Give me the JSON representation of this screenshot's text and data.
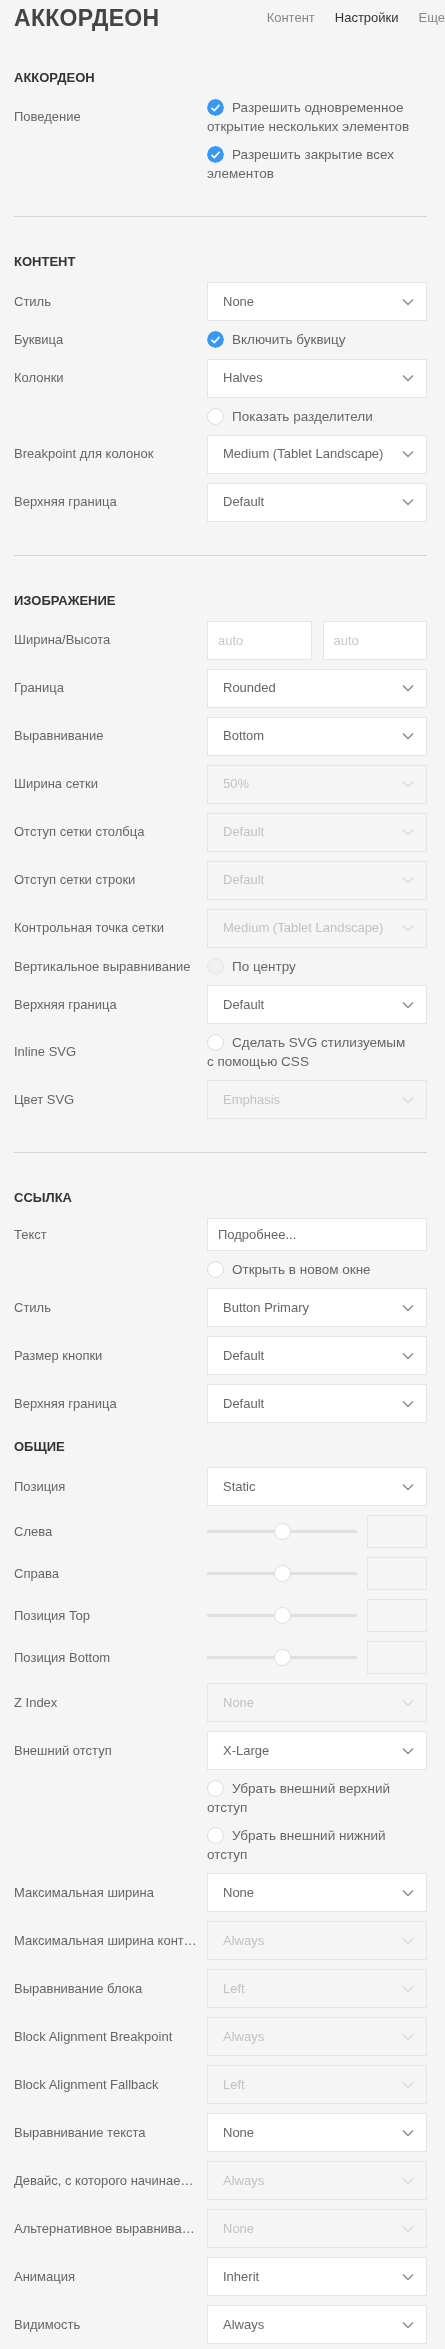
{
  "header": {
    "title": "АККОРДЕОН",
    "tabs": [
      {
        "label": "Контент",
        "selected": false
      },
      {
        "label": "Настройки",
        "selected": true
      },
      {
        "label": "Еще",
        "selected": false
      }
    ]
  },
  "sections": [
    {
      "heading": "АККОРДЕОН",
      "divider": true,
      "rows": [
        {
          "label": "Поведение",
          "controls": [
            {
              "kind": "checkbox",
              "text": "Разрешить одновременное открытие нескольких элементов",
              "checked": true,
              "disabled": false
            },
            {
              "kind": "checkbox",
              "text": "Разрешить закрытие всех элементов",
              "checked": true,
              "disabled": false
            }
          ]
        }
      ]
    },
    {
      "heading": "КОНТЕНТ",
      "divider": true,
      "rows": [
        {
          "label": "Стиль",
          "controls": [
            {
              "kind": "select",
              "value": "None",
              "disabled": false
            }
          ]
        },
        {
          "label": "Буквица",
          "controls": [
            {
              "kind": "checkbox",
              "text": "Включить буквицу",
              "checked": true,
              "disabled": false
            }
          ]
        },
        {
          "label": "Колонки",
          "controls": [
            {
              "kind": "select",
              "value": "Halves",
              "disabled": false
            },
            {
              "kind": "checkbox",
              "text": "Показать разделители",
              "checked": false,
              "disabled": false
            }
          ]
        },
        {
          "label": "Breakpoint для колонок",
          "controls": [
            {
              "kind": "select",
              "value": "Medium (Tablet Landscape)",
              "disabled": false
            }
          ]
        },
        {
          "label": "Верхняя граница",
          "controls": [
            {
              "kind": "select",
              "value": "Default",
              "disabled": false
            }
          ]
        }
      ]
    },
    {
      "heading": "ИЗОБРАЖЕНИЕ",
      "divider": true,
      "rows": [
        {
          "label": "Ширина/Высота",
          "controls": [
            {
              "kind": "pair",
              "fields": [
                {
                  "placeholder": "auto"
                },
                {
                  "placeholder": "auto"
                }
              ]
            }
          ]
        },
        {
          "label": "Граница",
          "controls": [
            {
              "kind": "select",
              "value": "Rounded",
              "disabled": false
            }
          ]
        },
        {
          "label": "Выравнивание",
          "controls": [
            {
              "kind": "select",
              "value": "Bottom",
              "disabled": false
            }
          ]
        },
        {
          "label": "Ширина сетки",
          "controls": [
            {
              "kind": "select",
              "value": "50%",
              "disabled": true
            }
          ]
        },
        {
          "label": "Отступ сетки столбца",
          "controls": [
            {
              "kind": "select",
              "value": "Default",
              "disabled": true
            }
          ]
        },
        {
          "label": "Отступ сетки строки",
          "controls": [
            {
              "kind": "select",
              "value": "Default",
              "disabled": true
            }
          ]
        },
        {
          "label": "Контрольная точка сетки",
          "controls": [
            {
              "kind": "select",
              "value": "Medium (Tablet Landscape)",
              "disabled": true
            }
          ]
        },
        {
          "label": "Вертикальное выравнивание",
          "controls": [
            {
              "kind": "checkbox",
              "text": "По центру",
              "checked": false,
              "disabled": true
            }
          ]
        },
        {
          "label": "Верхняя граница",
          "controls": [
            {
              "kind": "select",
              "value": "Default",
              "disabled": false
            }
          ]
        },
        {
          "label": "Inline SVG",
          "controls": [
            {
              "kind": "checkbox",
              "text": "Сделать SVG стилизуемым с помощью CSS",
              "checked": false,
              "disabled": false
            }
          ]
        },
        {
          "label": "Цвет SVG",
          "controls": [
            {
              "kind": "select",
              "value": "Emphasis",
              "disabled": true
            }
          ]
        }
      ]
    },
    {
      "heading": "ССЫЛКА",
      "divider": false,
      "rows": [
        {
          "label": "Текст",
          "controls": [
            {
              "kind": "text",
              "value": "Подробнее..."
            },
            {
              "kind": "checkbox",
              "text": "Открыть в новом окне",
              "checked": false,
              "disabled": false
            }
          ]
        },
        {
          "label": "Стиль",
          "controls": [
            {
              "kind": "select",
              "value": "Button Primary",
              "disabled": false
            }
          ]
        },
        {
          "label": "Размер кнопки",
          "controls": [
            {
              "kind": "select",
              "value": "Default",
              "disabled": false
            }
          ]
        },
        {
          "label": "Верхняя граница",
          "controls": [
            {
              "kind": "select",
              "value": "Default",
              "disabled": false
            }
          ]
        }
      ]
    },
    {
      "heading": "ОБЩИЕ",
      "divider": false,
      "rows": [
        {
          "label": "Позиция",
          "controls": [
            {
              "kind": "select",
              "value": "Static",
              "disabled": false
            }
          ]
        },
        {
          "label": "Слева",
          "controls": [
            {
              "kind": "slider",
              "level": 0.5
            }
          ]
        },
        {
          "label": "Справа",
          "controls": [
            {
              "kind": "slider",
              "level": 0.5
            }
          ]
        },
        {
          "label": "Позиция Top",
          "controls": [
            {
              "kind": "slider",
              "level": 0.5
            }
          ]
        },
        {
          "label": "Позиция Bottom",
          "controls": [
            {
              "kind": "slider",
              "level": 0.5
            }
          ]
        },
        {
          "label": "Z Index",
          "controls": [
            {
              "kind": "select",
              "value": "None",
              "disabled": true
            }
          ]
        },
        {
          "label": "Внешний отступ",
          "controls": [
            {
              "kind": "select",
              "value": "X-Large",
              "disabled": false
            },
            {
              "kind": "checkbox",
              "text": "Убрать внешний верхний отступ",
              "checked": false,
              "disabled": false
            },
            {
              "kind": "checkbox",
              "text": "Убрать внешний нижний отступ",
              "checked": false,
              "disabled": false
            }
          ]
        },
        {
          "label": "Максимальная ширина",
          "controls": [
            {
              "kind": "select",
              "value": "None",
              "disabled": false
            }
          ]
        },
        {
          "label": "Максимальная ширина конт…",
          "controls": [
            {
              "kind": "select",
              "value": "Always",
              "disabled": true
            }
          ]
        },
        {
          "label": "Выравнивание блока",
          "controls": [
            {
              "kind": "select",
              "value": "Left",
              "disabled": true
            }
          ]
        },
        {
          "label": "Block Alignment Breakpoint",
          "controls": [
            {
              "kind": "select",
              "value": "Always",
              "disabled": true
            }
          ]
        },
        {
          "label": "Block Alignment Fallback",
          "controls": [
            {
              "kind": "select",
              "value": "Left",
              "disabled": true
            }
          ]
        },
        {
          "label": "Выравнивание текста",
          "controls": [
            {
              "kind": "select",
              "value": "None",
              "disabled": false
            }
          ]
        },
        {
          "label": "Девайс, с которого начинае…",
          "controls": [
            {
              "kind": "select",
              "value": "Always",
              "disabled": true
            }
          ]
        },
        {
          "label": "Альтернативное выравнива…",
          "controls": [
            {
              "kind": "select",
              "value": "None",
              "disabled": true
            }
          ]
        },
        {
          "label": "Анимация",
          "controls": [
            {
              "kind": "select",
              "value": "Inherit",
              "disabled": false
            }
          ]
        },
        {
          "label": "Видимость",
          "controls": [
            {
              "kind": "select",
              "value": "Always",
              "disabled": false
            }
          ]
        }
      ]
    }
  ]
}
